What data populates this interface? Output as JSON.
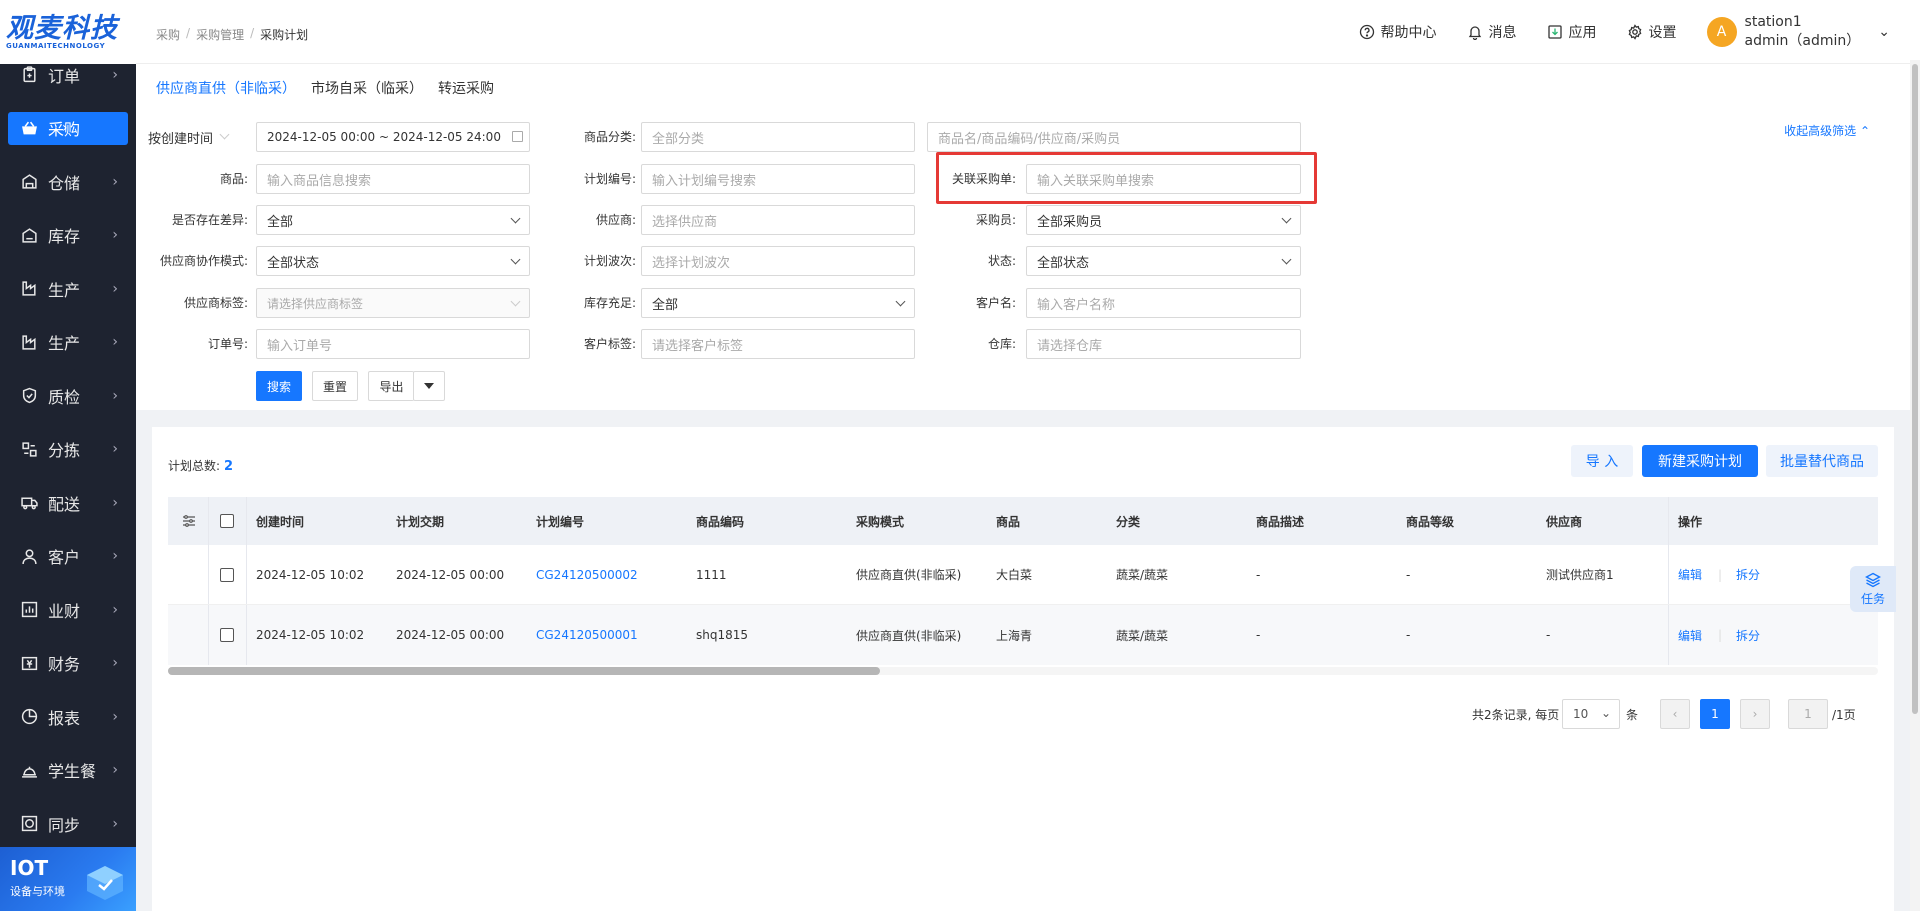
{
  "logo": {
    "main": "观麦科技",
    "sub": "GUANMAITECHNOLOGY"
  },
  "sidebar": {
    "items": [
      {
        "label": "订单",
        "icon": "clipboard-icon"
      },
      {
        "label": "采购",
        "icon": "basket-icon",
        "active": true
      },
      {
        "label": "仓储",
        "icon": "warehouse-icon"
      },
      {
        "label": "库存",
        "icon": "inventory-icon"
      },
      {
        "label": "生产",
        "icon": "factory-icon"
      },
      {
        "label": "生产",
        "icon": "factory-icon"
      },
      {
        "label": "质检",
        "icon": "shield-icon"
      },
      {
        "label": "分拣",
        "icon": "sort-icon"
      },
      {
        "label": "配送",
        "icon": "truck-icon"
      },
      {
        "label": "客户",
        "icon": "user-icon"
      },
      {
        "label": "业财",
        "icon": "chart-icon"
      },
      {
        "label": "财务",
        "icon": "money-icon"
      },
      {
        "label": "报表",
        "icon": "report-icon"
      },
      {
        "label": "学生餐",
        "icon": "dish-icon"
      },
      {
        "label": "同步",
        "icon": "sync-icon"
      }
    ],
    "iot": {
      "title": "IOT",
      "sub": "设备与环境"
    }
  },
  "header": {
    "breadcrumb": [
      "采购",
      "采购管理",
      "采购计划"
    ],
    "help": "帮助中心",
    "messages": "消息",
    "apps": "应用",
    "settings": "设置",
    "avatar_letter": "A",
    "user_line1": "station1",
    "user_line2": "admin（admin）"
  },
  "tabs": [
    "供应商直供（非临采）",
    "市场自采（临采）",
    "转运采购"
  ],
  "filters": {
    "date_type": "按创建时间",
    "date_range": "2024-12-05 00:00 ~ 2024-12-05 24:00",
    "category_label": "商品分类:",
    "category_placeholder": "全部分类",
    "keyword_placeholder": "商品名/商品编码/供应商/采购员",
    "collapse": "收起高级筛选",
    "goods_label": "商品:",
    "goods_placeholder": "输入商品信息搜索",
    "plan_no_label": "计划编号:",
    "plan_no_placeholder": "输入计划编号搜索",
    "po_label": "关联采购单:",
    "po_placeholder": "输入关联采购单搜索",
    "diff_label": "是否存在差异:",
    "diff_value": "全部",
    "supplier_label": "供应商:",
    "supplier_placeholder": "选择供应商",
    "buyer_label": "采购员:",
    "buyer_value": "全部采购员",
    "coop_label": "供应商协作模式:",
    "coop_value": "全部状态",
    "wave_label": "计划波次:",
    "wave_placeholder": "选择计划波次",
    "status_label": "状态:",
    "status_value": "全部状态",
    "sup_tag_label": "供应商标签:",
    "sup_tag_placeholder": "请选择供应商标签",
    "stock_label": "库存充足:",
    "stock_value": "全部",
    "customer_label": "客户名:",
    "customer_placeholder": "输入客户名称",
    "order_label": "订单号:",
    "order_placeholder": "输入订单号",
    "cust_tag_label": "客户标签:",
    "cust_tag_placeholder": "请选择客户标签",
    "wh_label": "仓库:",
    "wh_placeholder": "请选择仓库",
    "search_btn": "搜索",
    "reset_btn": "重置",
    "export_btn": "导出"
  },
  "table": {
    "total_label": "计划总数:",
    "total": "2",
    "import_btn": "导 入",
    "new_btn": "新建采购计划",
    "batch_btn": "批量替代商品",
    "columns": [
      "创建时间",
      "计划交期",
      "计划编号",
      "商品编码",
      "采购模式",
      "商品",
      "分类",
      "商品描述",
      "商品等级",
      "供应商",
      "操作"
    ],
    "rows": [
      [
        "2024-12-05 10:02",
        "2024-12-05 00:00",
        "CG24120500002",
        "1111",
        "供应商直供(非临采)",
        "大白菜",
        "蔬菜/蔬菜",
        "-",
        "-",
        "测试供应商1"
      ],
      [
        "2024-12-05 10:02",
        "2024-12-05 00:00",
        "CG24120500001",
        "shq1815",
        "供应商直供(非临采)",
        "上海青",
        "蔬菜/蔬菜",
        "-",
        "-",
        "-"
      ]
    ],
    "edit": "编辑",
    "split": "拆分"
  },
  "pager": {
    "summary": "共2条记录, 每页",
    "page_size": "10",
    "unit": "条",
    "prev": "‹",
    "current": "1",
    "next": "›",
    "jump_value": "1",
    "total_pages": "/1页"
  },
  "task": "任务"
}
